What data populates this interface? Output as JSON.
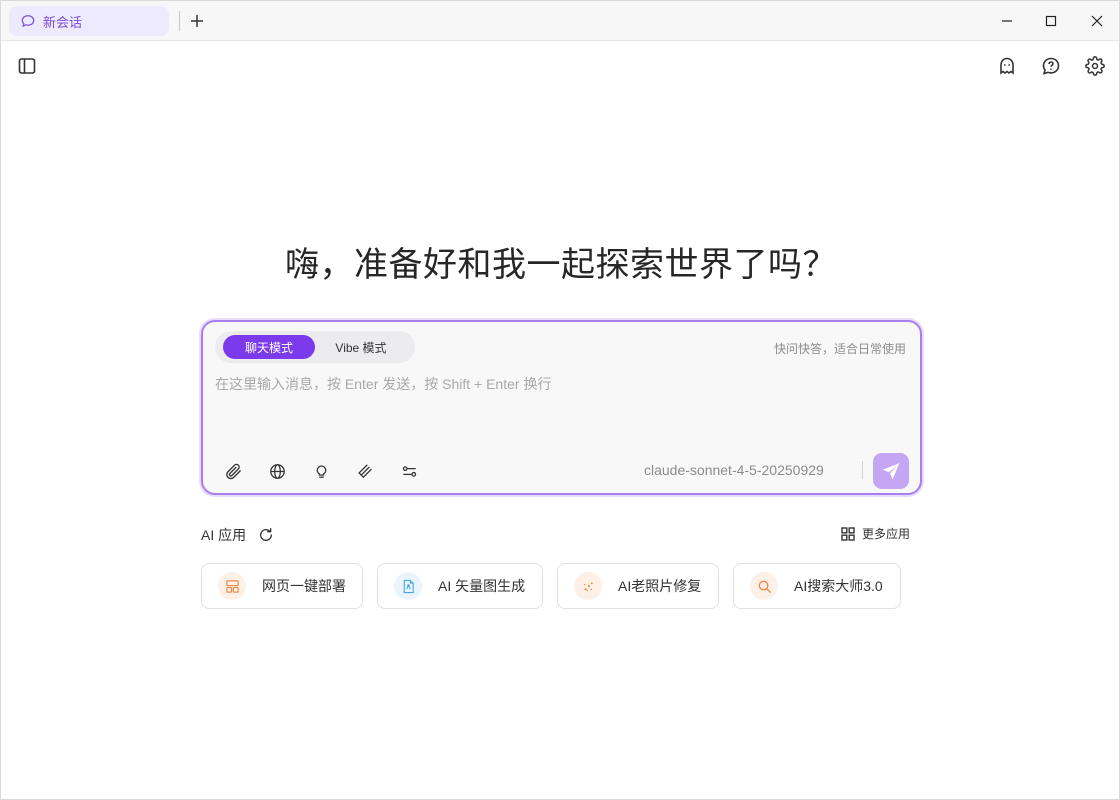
{
  "tabbar": {
    "active_tab": {
      "label": "新会话",
      "icon": "chat-bubble-icon"
    },
    "add_tab_icon": "plus-icon"
  },
  "window_controls": {
    "minimize_icon": "minimize-icon",
    "maximize_icon": "maximize-icon",
    "close_icon": "close-icon"
  },
  "toolbar": {
    "left": [
      "sidebar-toggle-icon"
    ],
    "right": [
      "ghost-icon",
      "help-icon",
      "gear-icon"
    ]
  },
  "main": {
    "headline": "嗨，准备好和我一起探索世界了吗？"
  },
  "composer": {
    "modes": [
      {
        "label": "聊天模式",
        "active": true
      },
      {
        "label": "Vibe 模式",
        "active": false
      }
    ],
    "mode_hint": "快问快答，适合日常使用",
    "placeholder": "在这里输入消息，按 Enter 发送，按 Shift + Enter 换行",
    "value": "",
    "tools": [
      "paperclip-icon",
      "globe-icon",
      "lightbulb-icon",
      "layers-icon",
      "sliders-icon"
    ],
    "model": "claude-sonnet-4-5-20250929",
    "send_icon": "send-icon"
  },
  "apps": {
    "title": "AI 应用",
    "more_label": "更多应用",
    "items": [
      {
        "label": "网页一键部署",
        "icon": "layout-icon",
        "color": "#f08a4b"
      },
      {
        "label": "AI 矢量图生成",
        "icon": "vector-file-icon",
        "color": "#4aa8e8"
      },
      {
        "label": "AI老照片修复",
        "icon": "sparkle-icon",
        "color": "#f08a4b"
      },
      {
        "label": "AI搜索大师3.0",
        "icon": "search-icon",
        "color": "#f08a4b"
      }
    ]
  },
  "colors": {
    "accent": "#7c3aed",
    "accent_light": "#c4a6f5",
    "card_border": "#a97ff0"
  }
}
